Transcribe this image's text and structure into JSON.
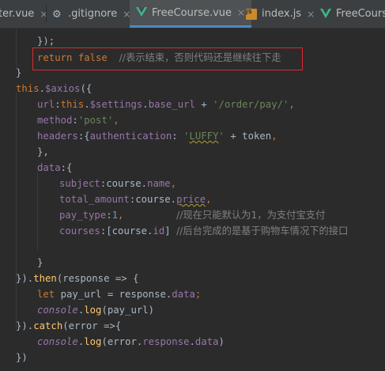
{
  "tabs": [
    {
      "label": "ter.vue",
      "icon": "none-icon",
      "active": false
    },
    {
      "label": ".gitignore",
      "icon": "gear-icon",
      "active": false
    },
    {
      "label": "FreeCourse.vue",
      "icon": "vue-icon",
      "active": true
    },
    {
      "label": "index.js",
      "icon": "js-file-icon",
      "active": false
    },
    {
      "label": "FreeCourse",
      "icon": "vue-icon",
      "active": false
    }
  ],
  "close_glyph": "×",
  "js_badge": "JS",
  "code": {
    "l1": "});",
    "l2_kw": "return false",
    "l2_cm": "//表示结束，否则代码还是继续往下走",
    "l3": "}",
    "l4_a": "this",
    "l4_b": ".",
    "l4_c": "$axios",
    "l4_d": "({",
    "l5_a": "url",
    "l5_b": ":",
    "l5_c": "this",
    "l5_d": ".",
    "l5_e": "$settings",
    "l5_f": ".",
    "l5_g": "base_url",
    "l5_h": " + ",
    "l5_i": "'/order/pay/'",
    "l5_j": ",",
    "l6_a": "method",
    "l6_b": ":",
    "l6_c": "'post'",
    "l6_d": ",",
    "l7_a": "headers",
    "l7_b": ":{",
    "l7_c": "authentication",
    "l7_d": ": ",
    "l7_e": "'",
    "l7_f": "LUFFY",
    "l7_g": "'",
    "l7_h": " + token",
    "l7_i": ",",
    "l8": "},",
    "l9_a": "data",
    "l9_b": ":{",
    "l10_a": "subject",
    "l10_b": ":course.",
    "l10_c": "name",
    "l10_d": ",",
    "l11_a": "total_amount",
    "l11_b": ":course.",
    "l11_c": "price",
    "l11_d": ",",
    "l12_a": "pay_type",
    "l12_b": ":",
    "l12_c": "1",
    "l12_d": ",",
    "l12_cm": "//现在只能默认为1，为支付宝支付",
    "l13_a": "courses",
    "l13_b": ":[course.",
    "l13_c": "id",
    "l13_d": "]",
    "l13_cm": "//后台完成的是基于购物车情况下的接口",
    "l14": "}",
    "l15_a": "}).",
    "l15_b": "then",
    "l15_c": "(response => {",
    "l16_a": "let",
    "l16_b": " pay_url = response.",
    "l16_c": "data",
    "l16_d": ";",
    "l17_a": "console",
    "l17_b": ".",
    "l17_c": "log",
    "l17_d": "(pay_url)",
    "l18_a": "}).",
    "l18_b": "catch",
    "l18_c": "(error =>{",
    "l19_a": "console",
    "l19_b": ".",
    "l19_c": "log",
    "l19_d": "(error.",
    "l19_e": "response",
    "l19_f": ".",
    "l19_g": "data",
    "l19_h": ")",
    "l20": "})"
  }
}
